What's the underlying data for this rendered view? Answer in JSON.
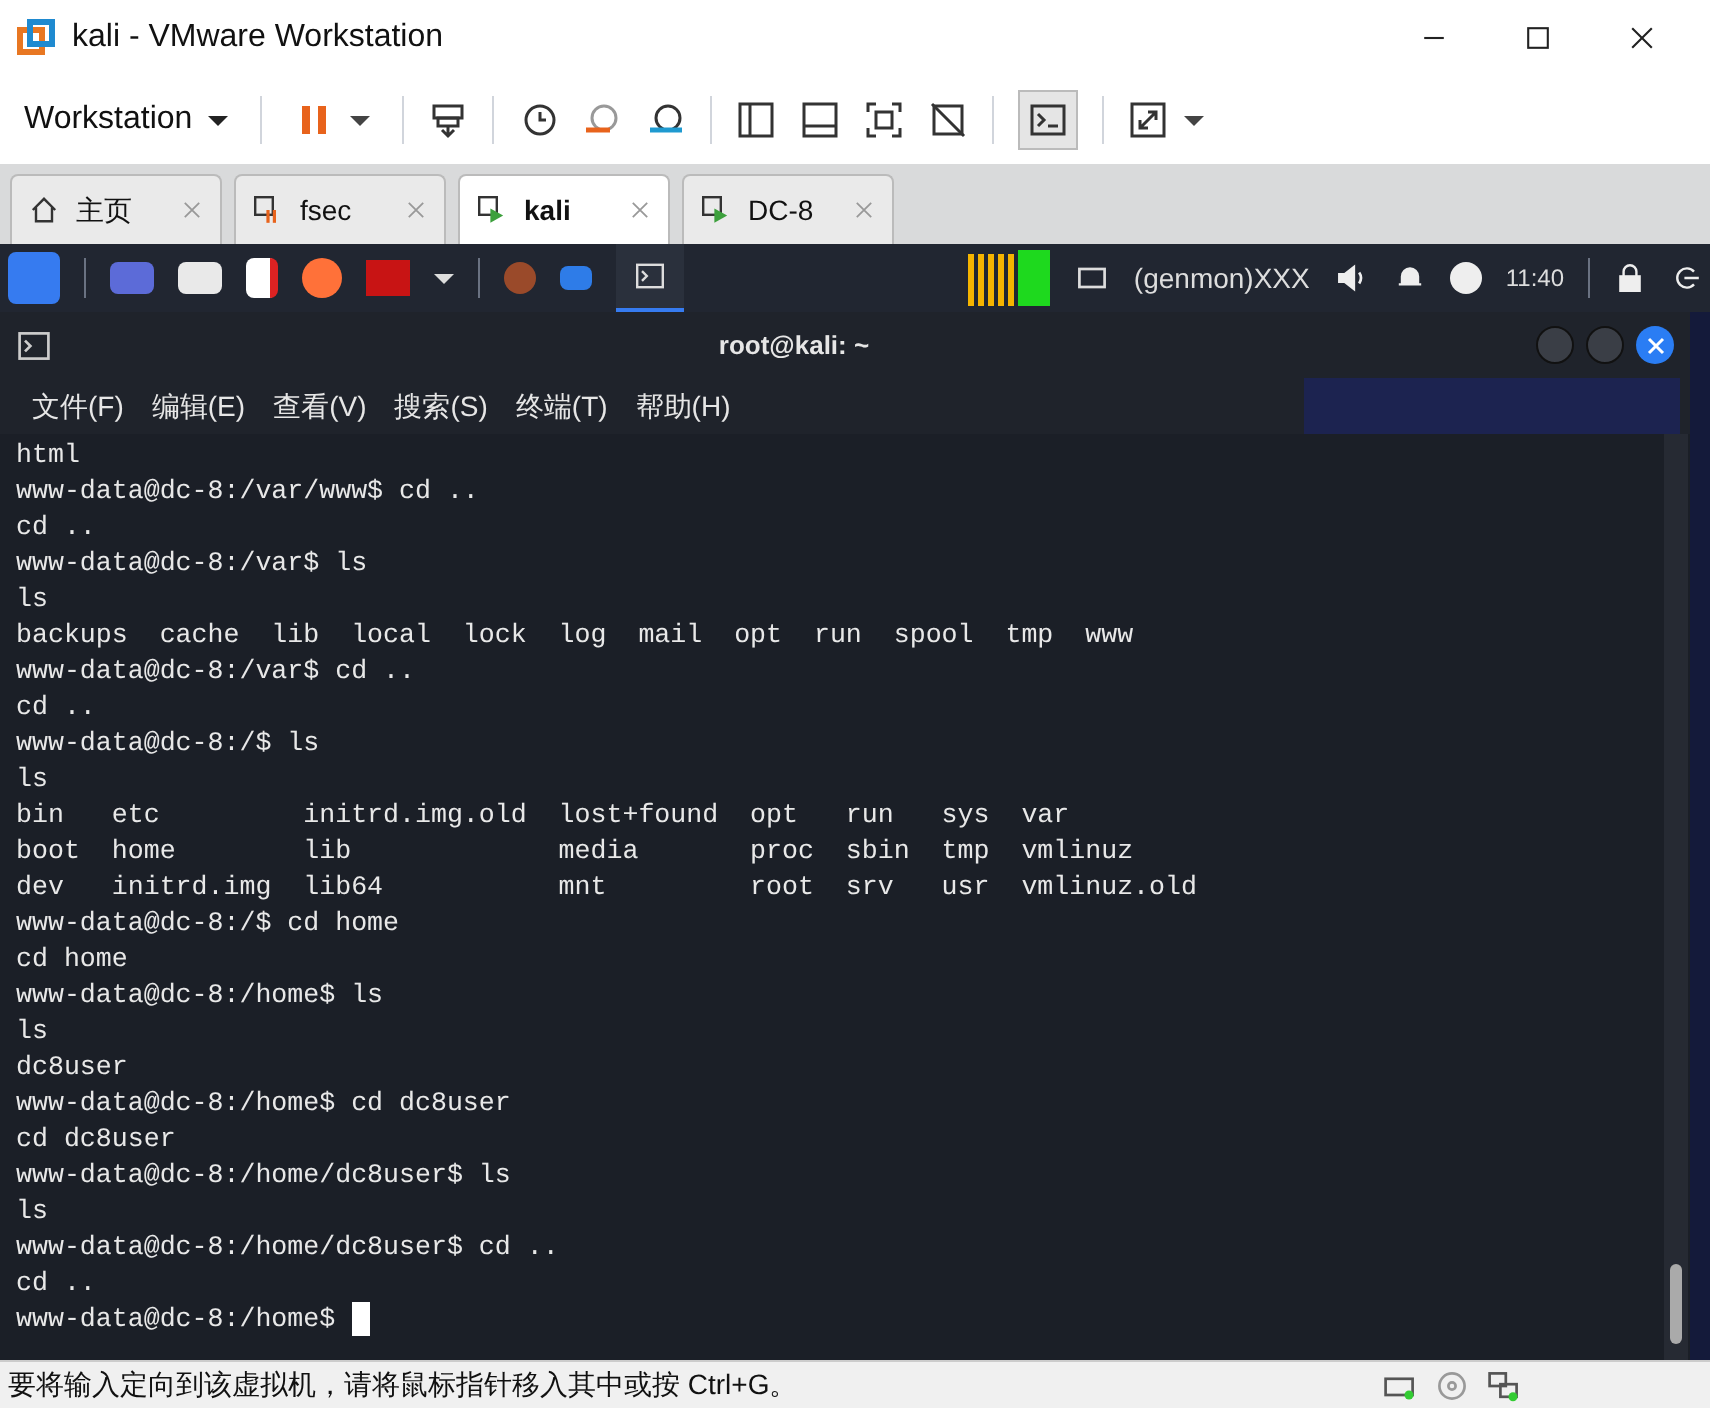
{
  "window": {
    "title": "kali - VMware Workstation"
  },
  "toolbar": {
    "menu": "Workstation"
  },
  "tabs": [
    {
      "label": "主页",
      "kind": "home",
      "selected": false
    },
    {
      "label": "fsec",
      "kind": "paused",
      "selected": false
    },
    {
      "label": "kali",
      "kind": "running",
      "selected": true
    },
    {
      "label": "DC-8",
      "kind": "running",
      "selected": false
    }
  ],
  "panel": {
    "genmon": "(genmon)XXX",
    "clock": "11:40"
  },
  "terminal": {
    "title": "root@kali: ~",
    "menu": [
      "文件(F)",
      "编辑(E)",
      "查看(V)",
      "搜索(S)",
      "终端(T)",
      "帮助(H)"
    ],
    "lines": [
      "html",
      "www-data@dc-8:/var/www$ cd ..",
      "cd ..",
      "www-data@dc-8:/var$ ls",
      "ls",
      "backups  cache  lib  local  lock  log  mail  opt  run  spool  tmp  www",
      "www-data@dc-8:/var$ cd ..",
      "cd ..",
      "www-data@dc-8:/$ ls",
      "ls",
      "bin   etc         initrd.img.old  lost+found  opt   run   sys  var",
      "boot  home        lib             media       proc  sbin  tmp  vmlinuz",
      "dev   initrd.img  lib64           mnt         root  srv   usr  vmlinuz.old",
      "www-data@dc-8:/$ cd home",
      "cd home",
      "www-data@dc-8:/home$ ls",
      "ls",
      "dc8user",
      "www-data@dc-8:/home$ cd dc8user",
      "cd dc8user",
      "www-data@dc-8:/home/dc8user$ ls",
      "ls",
      "www-data@dc-8:/home/dc8user$ cd ..",
      "cd ..",
      "www-data@dc-8:/home$ "
    ]
  },
  "status_bar": {
    "text": "要将输入定向到该虚拟机，请将鼠标指针移入其中或按 Ctrl+G。"
  }
}
